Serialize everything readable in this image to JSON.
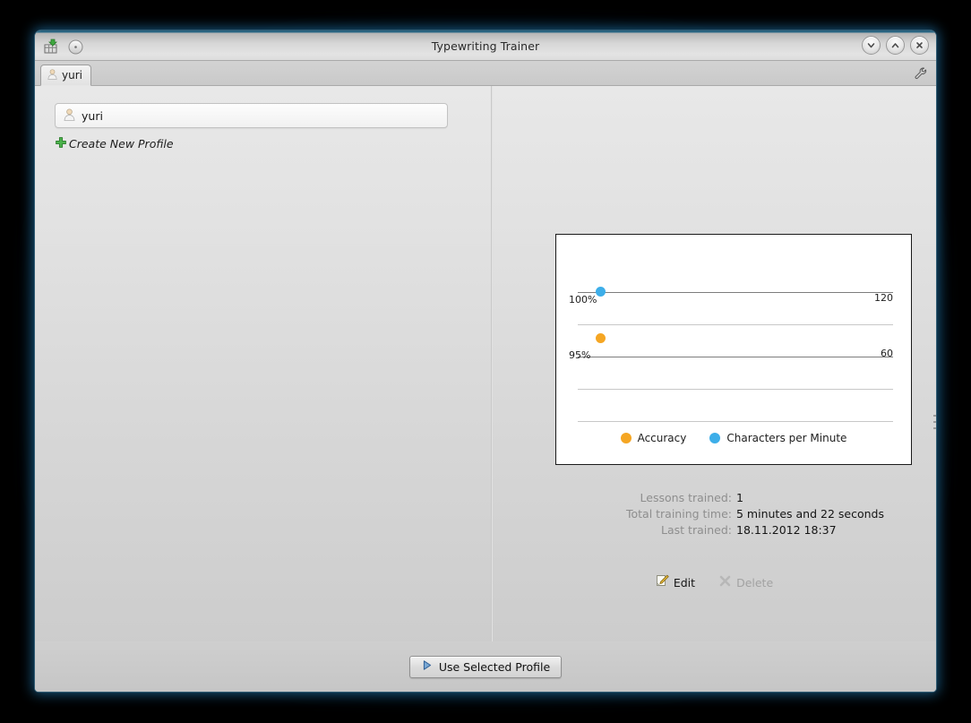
{
  "window": {
    "title": "Typewriting Trainer",
    "toolbar_icons": [
      {
        "name": "install-app-icon"
      },
      {
        "name": "about-circle-icon"
      }
    ],
    "controls": [
      {
        "name": "minimize-button",
        "label": "Minimize"
      },
      {
        "name": "maximize-button",
        "label": "Maximize"
      },
      {
        "name": "close-button",
        "label": "Close"
      }
    ]
  },
  "tabbar": {
    "tabs": [
      {
        "label": "yuri",
        "icon": "user-avatar-icon"
      }
    ],
    "corner_tool": "configure-wrench-icon"
  },
  "left_pane": {
    "profiles": [
      {
        "name": "yuri"
      }
    ],
    "create_new_label": "Create New Profile",
    "create_new_icon": "plus-icon"
  },
  "chart_data": {
    "type": "line",
    "title": "",
    "x": [
      1
    ],
    "series": [
      {
        "name": "Accuracy",
        "values": [
          97.5
        ],
        "color": "#f5a623",
        "axis": "left"
      },
      {
        "name": "Characters per Minute",
        "values": [
          120
        ],
        "color": "#3daee9",
        "axis": "right"
      }
    ],
    "left_axis": {
      "label": "",
      "ticks": [
        "100%",
        "95%"
      ],
      "ylim": [
        85,
        105
      ]
    },
    "right_axis": {
      "label": "",
      "ticks": [
        "120",
        "60"
      ],
      "ylim": [
        0,
        180
      ]
    },
    "gridlines": 5,
    "grid": true,
    "legend": {
      "position": "bottom",
      "entries": [
        {
          "label": "Accuracy",
          "color": "#f5a623"
        },
        {
          "label": "Characters per Minute",
          "color": "#3daee9"
        }
      ]
    }
  },
  "stats": [
    {
      "label": "Lessons trained:",
      "value": "1"
    },
    {
      "label": "Total training time:",
      "value": "5 minutes and 22 seconds"
    },
    {
      "label": "Last trained:",
      "value": "18.11.2012 18:37"
    }
  ],
  "actions": {
    "edit": {
      "label": "Edit",
      "icon": "pencil-edit-icon",
      "enabled": true
    },
    "delete": {
      "label": "Delete",
      "icon": "delete-x-icon",
      "enabled": false
    }
  },
  "footer": {
    "use_profile_label": "Use Selected Profile",
    "use_profile_icon": "play-triangle-icon"
  },
  "colors": {
    "accuracy": "#f5a623",
    "cpm": "#3daee9",
    "titlebar_accent": "#2d6b88"
  }
}
